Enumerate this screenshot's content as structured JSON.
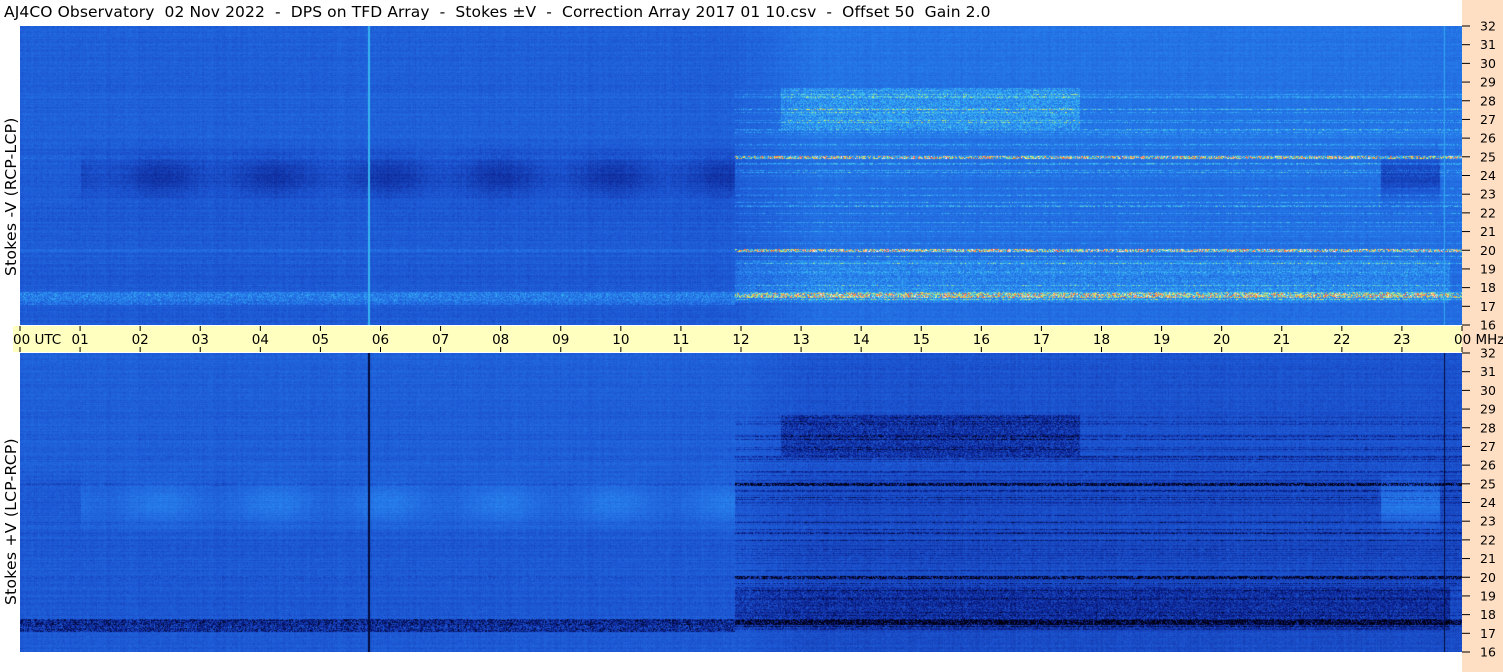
{
  "title": "AJ4CO Observatory  02 Nov 2022  -  DPS on TFD Array  -  Stokes ±V  -  Correction Array 2017 01 10.csv  -  Offset 50  Gain 2.0",
  "colors": {
    "background": "#ffffff",
    "right_strip": "#ffdfc4",
    "time_band": "#ffffc0",
    "colormap": [
      "#000010",
      "#0a1f8c",
      "#1f58d4",
      "#2c86ee",
      "#3fc4f2",
      "#ffff40",
      "#ff4030",
      "#ffffff"
    ]
  },
  "chart_data": [
    {
      "type": "heatmap",
      "panel": "top",
      "title": "",
      "ylabel": "Stokes -V (RCP-LCP)",
      "y_unit": "MHz",
      "y_range": [
        16,
        32
      ],
      "y_ticks": [
        "32",
        "31",
        "30",
        "29",
        "28",
        "27",
        "26",
        "25",
        "24",
        "23",
        "22",
        "21",
        "20",
        "19",
        "18",
        "17",
        "16"
      ],
      "x_range_hours": [
        0,
        24
      ],
      "x_ticks": [
        "00 UTC",
        "01",
        "02",
        "03",
        "04",
        "05",
        "06",
        "07",
        "08",
        "09",
        "10",
        "11",
        "12",
        "13",
        "14",
        "15",
        "16",
        "17",
        "18",
        "19",
        "20",
        "21",
        "22",
        "23",
        "00 MHz"
      ],
      "features": {
        "quiet_until_utc": 11.9,
        "dark_band_mhz": [
          23,
          25
        ],
        "bright_rfi_mhz": [
          17.5,
          28
        ],
        "vertical_line_utc": 5.8,
        "sign": -1
      }
    },
    {
      "type": "heatmap",
      "panel": "bottom",
      "title": "",
      "ylabel": "Stokes +V (LCP-RCP)",
      "y_unit": "MHz",
      "y_range": [
        16,
        32
      ],
      "y_ticks": [
        "32",
        "31",
        "30",
        "29",
        "28",
        "27",
        "26",
        "25",
        "24",
        "23",
        "22",
        "21",
        "20",
        "19",
        "18",
        "17",
        "16"
      ],
      "x_range_hours": [
        0,
        24
      ],
      "x_ticks": [
        "00 UTC",
        "01",
        "02",
        "03",
        "04",
        "05",
        "06",
        "07",
        "08",
        "09",
        "10",
        "11",
        "12",
        "13",
        "14",
        "15",
        "16",
        "17",
        "18",
        "19",
        "20",
        "21",
        "22",
        "23",
        "00 MHz"
      ],
      "features": {
        "quiet_until_utc": 11.9,
        "bright_band_mhz": [
          23,
          25
        ],
        "dark_rfi_mhz": [
          17.5,
          28
        ],
        "vertical_line_utc": 5.8,
        "sign": 1
      }
    }
  ]
}
